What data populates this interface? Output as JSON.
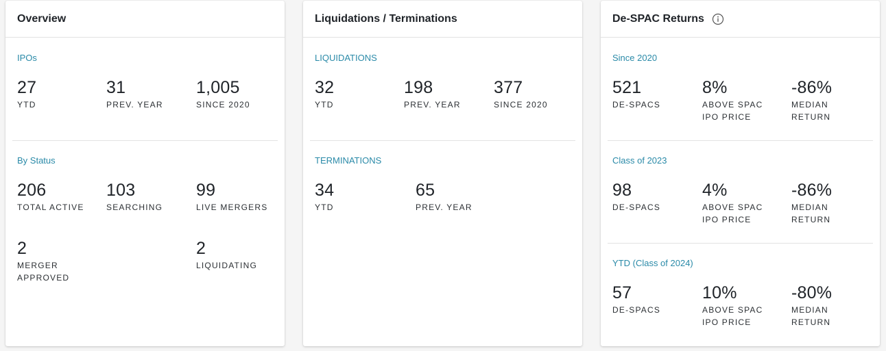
{
  "overview": {
    "title": "Overview",
    "ipos": {
      "title": "IPOs",
      "stats": [
        {
          "value": "27",
          "label": "YTD"
        },
        {
          "value": "31",
          "label": "PREV. YEAR"
        },
        {
          "value": "1,005",
          "label": "SINCE 2020"
        }
      ]
    },
    "by_status": {
      "title": "By Status",
      "stats": [
        {
          "value": "206",
          "label": "TOTAL ACTIVE"
        },
        {
          "value": "103",
          "label": "SEARCHING"
        },
        {
          "value": "99",
          "label": "LIVE MERGERS"
        },
        {
          "value": "2",
          "label_line1": "MERGER",
          "label_line2": "APPROVED"
        },
        {
          "value": "2",
          "label": "LIQUIDATING"
        }
      ]
    }
  },
  "liquidations": {
    "title": "Liquidations / Terminations",
    "liquidations": {
      "title": "LIQUIDATIONS",
      "stats": [
        {
          "value": "32",
          "label": "YTD"
        },
        {
          "value": "198",
          "label": "PREV. YEAR"
        },
        {
          "value": "377",
          "label": "SINCE 2020"
        }
      ]
    },
    "terminations": {
      "title": "TERMINATIONS",
      "stats": [
        {
          "value": "34",
          "label": "YTD"
        },
        {
          "value": "65",
          "label": "PREV. YEAR"
        }
      ]
    }
  },
  "despac": {
    "title": "De-SPAC Returns",
    "info_icon": "info-circle-icon",
    "since_2020": {
      "title": "Since 2020",
      "stats": [
        {
          "value": "521",
          "label_line1": "DE-SPACS",
          "label_line2": ""
        },
        {
          "value": "8%",
          "label_line1": "ABOVE SPAC",
          "label_line2": "IPO PRICE"
        },
        {
          "value": "-86%",
          "label_line1": "MEDIAN",
          "label_line2": "RETURN"
        }
      ]
    },
    "class_2023": {
      "title": "Class of 2023",
      "stats": [
        {
          "value": "98",
          "label_line1": "DE-SPACS",
          "label_line2": ""
        },
        {
          "value": "4%",
          "label_line1": "ABOVE SPAC",
          "label_line2": "IPO PRICE"
        },
        {
          "value": "-86%",
          "label_line1": "MEDIAN",
          "label_line2": "RETURN"
        }
      ]
    },
    "ytd_2024": {
      "title": "YTD (Class of 2024)",
      "stats": [
        {
          "value": "57",
          "label_line1": "DE-SPACS",
          "label_line2": ""
        },
        {
          "value": "10%",
          "label_line1": "ABOVE SPAC",
          "label_line2": "IPO PRICE"
        },
        {
          "value": "-80%",
          "label_line1": "MEDIAN",
          "label_line2": "RETURN"
        }
      ]
    }
  },
  "colors": {
    "accent": "#2a8aa8",
    "text": "#1f2328",
    "divider": "#e2e2e2",
    "background": "#f5f5f5",
    "card": "#ffffff"
  }
}
